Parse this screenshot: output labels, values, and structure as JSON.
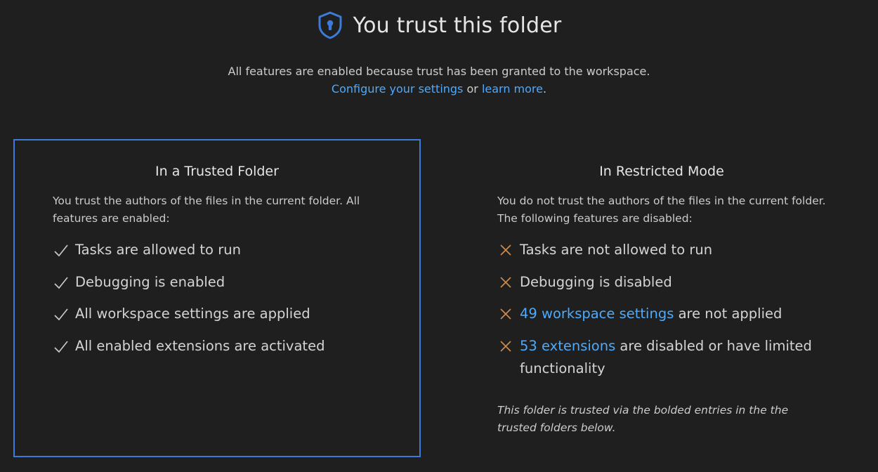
{
  "header": {
    "icon": "shield-lock-icon",
    "title": "You trust this folder"
  },
  "subtitle": {
    "line1": "All features are enabled because trust has been granted to the workspace.",
    "configure_link": "Configure your settings",
    "or_text": " or ",
    "learn_link": "learn more",
    "period": "."
  },
  "trusted": {
    "heading": "In a Trusted Folder",
    "description": "You trust the authors of the files in the current folder. All features are enabled:",
    "items": [
      {
        "icon": "check-icon",
        "text": "Tasks are allowed to run"
      },
      {
        "icon": "check-icon",
        "text": "Debugging is enabled"
      },
      {
        "icon": "check-icon",
        "text": "All workspace settings are applied"
      },
      {
        "icon": "check-icon",
        "text": "All enabled extensions are activated"
      }
    ]
  },
  "restricted": {
    "heading": "In Restricted Mode",
    "description": "You do not trust the authors of the files in the current folder. The following features are disabled:",
    "items": [
      {
        "icon": "x-icon",
        "text": "Tasks are not allowed to run"
      },
      {
        "icon": "x-icon",
        "text": "Debugging is disabled"
      },
      {
        "icon": "x-icon",
        "link": "49 workspace settings",
        "text": " are not applied"
      },
      {
        "icon": "x-icon",
        "link": "53 extensions",
        "text": " are disabled or have limited functionality"
      }
    ],
    "note": "This folder is trusted via the bolded entries in the the trusted folders below."
  },
  "colors": {
    "background": "#1f1f1f",
    "accent_border": "#3c7bd9",
    "link": "#4daafc",
    "cross": "#d18b4f",
    "shield": "#3c7bd9"
  }
}
